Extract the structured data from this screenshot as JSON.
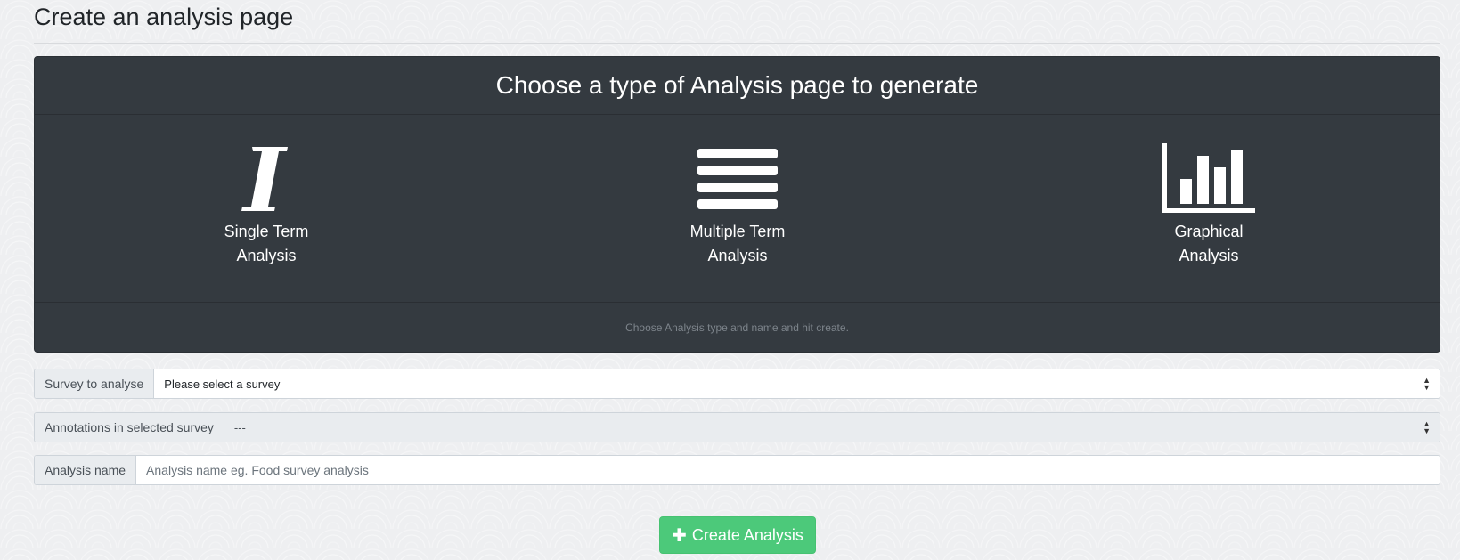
{
  "page": {
    "title": "Create an analysis page"
  },
  "chooser": {
    "heading": "Choose a type of Analysis page to generate",
    "options": [
      {
        "icon": "italic-i-icon",
        "label_line1": "Single Term",
        "label_line2": "Analysis"
      },
      {
        "icon": "list-bars-icon",
        "label_line1": "Multiple Term",
        "label_line2": "Analysis"
      },
      {
        "icon": "bar-chart-icon",
        "label_line1": "Graphical",
        "label_line2": "Analysis"
      }
    ],
    "footer_hint": "Choose Analysis type and name and hit create."
  },
  "form": {
    "survey": {
      "label": "Survey to analyse",
      "selected": "Please select a survey"
    },
    "annotations": {
      "label": "Annotations in selected survey",
      "selected": "---"
    },
    "name": {
      "label": "Analysis name",
      "value": "",
      "placeholder": "Analysis name eg. Food survey analysis"
    }
  },
  "actions": {
    "create_label": "Create Analysis",
    "create_icon": "plus-icon"
  },
  "colors": {
    "card_bg": "#343a40",
    "success": "#4cc97a",
    "page_bg": "#eeeff1"
  }
}
